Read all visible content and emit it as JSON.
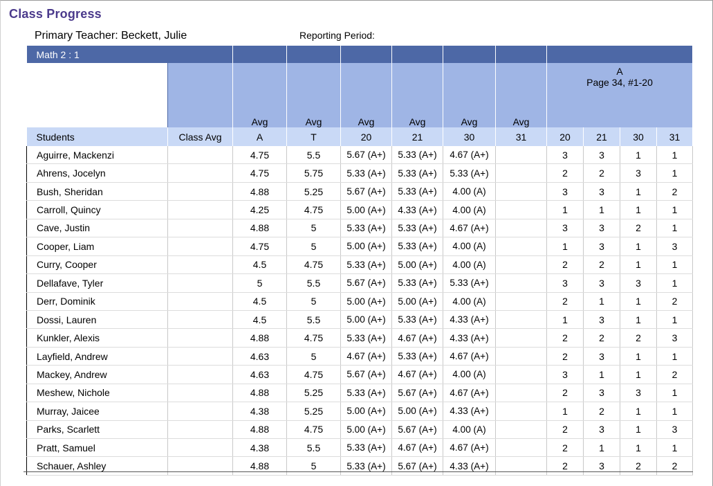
{
  "page": {
    "title": "Class Progress",
    "teacher_line": "Primary Teacher: Beckett, Julie",
    "reporting_period": "Reporting Period:"
  },
  "table": {
    "class_name": "Math 2 : 1",
    "avg_headers": [
      "Avg",
      "Avg",
      "Avg",
      "Avg",
      "Avg",
      "Avg"
    ],
    "assignment": {
      "title": "A",
      "subtitle": "Page 34, #1-20"
    },
    "columns": [
      "Students",
      "Class Avg",
      "A",
      "T",
      "20",
      "21",
      "30",
      "31",
      "20",
      "21",
      "30",
      "31"
    ],
    "rows": [
      {
        "name": "Aguirre, Mackenzi",
        "class_avg": "",
        "a": "4.75",
        "t": "5.5",
        "avg20": "5.67 (A+)",
        "avg21": "5.33 (A+)",
        "avg30": "4.67 (A+)",
        "avg31": "",
        "s20": "3",
        "s21": "3",
        "s30": "1",
        "s31": "1"
      },
      {
        "name": "Ahrens, Jocelyn",
        "class_avg": "",
        "a": "4.75",
        "t": "5.75",
        "avg20": "5.33 (A+)",
        "avg21": "5.33 (A+)",
        "avg30": "5.33 (A+)",
        "avg31": "",
        "s20": "2",
        "s21": "2",
        "s30": "3",
        "s31": "1"
      },
      {
        "name": "Bush, Sheridan",
        "class_avg": "",
        "a": "4.88",
        "t": "5.25",
        "avg20": "5.67 (A+)",
        "avg21": "5.33 (A+)",
        "avg30": "4.00 (A)",
        "avg31": "",
        "s20": "3",
        "s21": "3",
        "s30": "1",
        "s31": "2"
      },
      {
        "name": "Carroll, Quincy",
        "class_avg": "",
        "a": "4.25",
        "t": "4.75",
        "avg20": "5.00 (A+)",
        "avg21": "4.33 (A+)",
        "avg30": "4.00 (A)",
        "avg31": "",
        "s20": "1",
        "s21": "1",
        "s30": "1",
        "s31": "1"
      },
      {
        "name": "Cave, Justin",
        "class_avg": "",
        "a": "4.88",
        "t": "5",
        "avg20": "5.33 (A+)",
        "avg21": "5.33 (A+)",
        "avg30": "4.67 (A+)",
        "avg31": "",
        "s20": "3",
        "s21": "3",
        "s30": "2",
        "s31": "1"
      },
      {
        "name": "Cooper, Liam",
        "class_avg": "",
        "a": "4.75",
        "t": "5",
        "avg20": "5.00 (A+)",
        "avg21": "5.33 (A+)",
        "avg30": "4.00 (A)",
        "avg31": "",
        "s20": "1",
        "s21": "3",
        "s30": "1",
        "s31": "3"
      },
      {
        "name": "Curry, Cooper",
        "class_avg": "",
        "a": "4.5",
        "t": "4.75",
        "avg20": "5.33 (A+)",
        "avg21": "5.00 (A+)",
        "avg30": "4.00 (A)",
        "avg31": "",
        "s20": "2",
        "s21": "2",
        "s30": "1",
        "s31": "1"
      },
      {
        "name": "Dellafave, Tyler",
        "class_avg": "",
        "a": "5",
        "t": "5.5",
        "avg20": "5.67 (A+)",
        "avg21": "5.33 (A+)",
        "avg30": "5.33 (A+)",
        "avg31": "",
        "s20": "3",
        "s21": "3",
        "s30": "3",
        "s31": "1"
      },
      {
        "name": "Derr, Dominik",
        "class_avg": "",
        "a": "4.5",
        "t": "5",
        "avg20": "5.00 (A+)",
        "avg21": "5.00 (A+)",
        "avg30": "4.00 (A)",
        "avg31": "",
        "s20": "2",
        "s21": "1",
        "s30": "1",
        "s31": "2"
      },
      {
        "name": "Dossi, Lauren",
        "class_avg": "",
        "a": "4.5",
        "t": "5.5",
        "avg20": "5.00 (A+)",
        "avg21": "5.33 (A+)",
        "avg30": "4.33 (A+)",
        "avg31": "",
        "s20": "1",
        "s21": "3",
        "s30": "1",
        "s31": "1"
      },
      {
        "name": "Kunkler, Alexis",
        "class_avg": "",
        "a": "4.88",
        "t": "4.75",
        "avg20": "5.33 (A+)",
        "avg21": "4.67 (A+)",
        "avg30": "4.33 (A+)",
        "avg31": "",
        "s20": "2",
        "s21": "2",
        "s30": "2",
        "s31": "3"
      },
      {
        "name": "Layfield, Andrew",
        "class_avg": "",
        "a": "4.63",
        "t": "5",
        "avg20": "4.67 (A+)",
        "avg21": "5.33 (A+)",
        "avg30": "4.67 (A+)",
        "avg31": "",
        "s20": "2",
        "s21": "3",
        "s30": "1",
        "s31": "1"
      },
      {
        "name": "Mackey, Andrew",
        "class_avg": "",
        "a": "4.63",
        "t": "4.75",
        "avg20": "5.67 (A+)",
        "avg21": "4.67 (A+)",
        "avg30": "4.00 (A)",
        "avg31": "",
        "s20": "3",
        "s21": "1",
        "s30": "1",
        "s31": "2"
      },
      {
        "name": "Meshew, Nichole",
        "class_avg": "",
        "a": "4.88",
        "t": "5.25",
        "avg20": "5.33 (A+)",
        "avg21": "5.67 (A+)",
        "avg30": "4.67 (A+)",
        "avg31": "",
        "s20": "2",
        "s21": "3",
        "s30": "3",
        "s31": "1"
      },
      {
        "name": "Murray, Jaicee",
        "class_avg": "",
        "a": "4.38",
        "t": "5.25",
        "avg20": "5.00 (A+)",
        "avg21": "5.00 (A+)",
        "avg30": "4.33 (A+)",
        "avg31": "",
        "s20": "1",
        "s21": "2",
        "s30": "1",
        "s31": "1"
      },
      {
        "name": "Parks, Scarlett",
        "class_avg": "",
        "a": "4.88",
        "t": "4.75",
        "avg20": "5.00 (A+)",
        "avg21": "5.67 (A+)",
        "avg30": "4.00 (A)",
        "avg31": "",
        "s20": "2",
        "s21": "3",
        "s30": "1",
        "s31": "3"
      },
      {
        "name": "Pratt, Samuel",
        "class_avg": "",
        "a": "4.38",
        "t": "5.5",
        "avg20": "5.33 (A+)",
        "avg21": "4.67 (A+)",
        "avg30": "4.67 (A+)",
        "avg31": "",
        "s20": "2",
        "s21": "1",
        "s30": "1",
        "s31": "1"
      },
      {
        "name": "Schauer, Ashley",
        "class_avg": "",
        "a": "4.88",
        "t": "5",
        "avg20": "5.33 (A+)",
        "avg21": "5.67 (A+)",
        "avg30": "4.33 (A+)",
        "avg31": "",
        "s20": "2",
        "s21": "3",
        "s30": "2",
        "s31": "2"
      }
    ]
  },
  "colors": {
    "title": "#4b3a8c",
    "class_bar": "#4d68a6",
    "avg_header": "#9fb5e5",
    "column_header": "#c9d9f6"
  }
}
